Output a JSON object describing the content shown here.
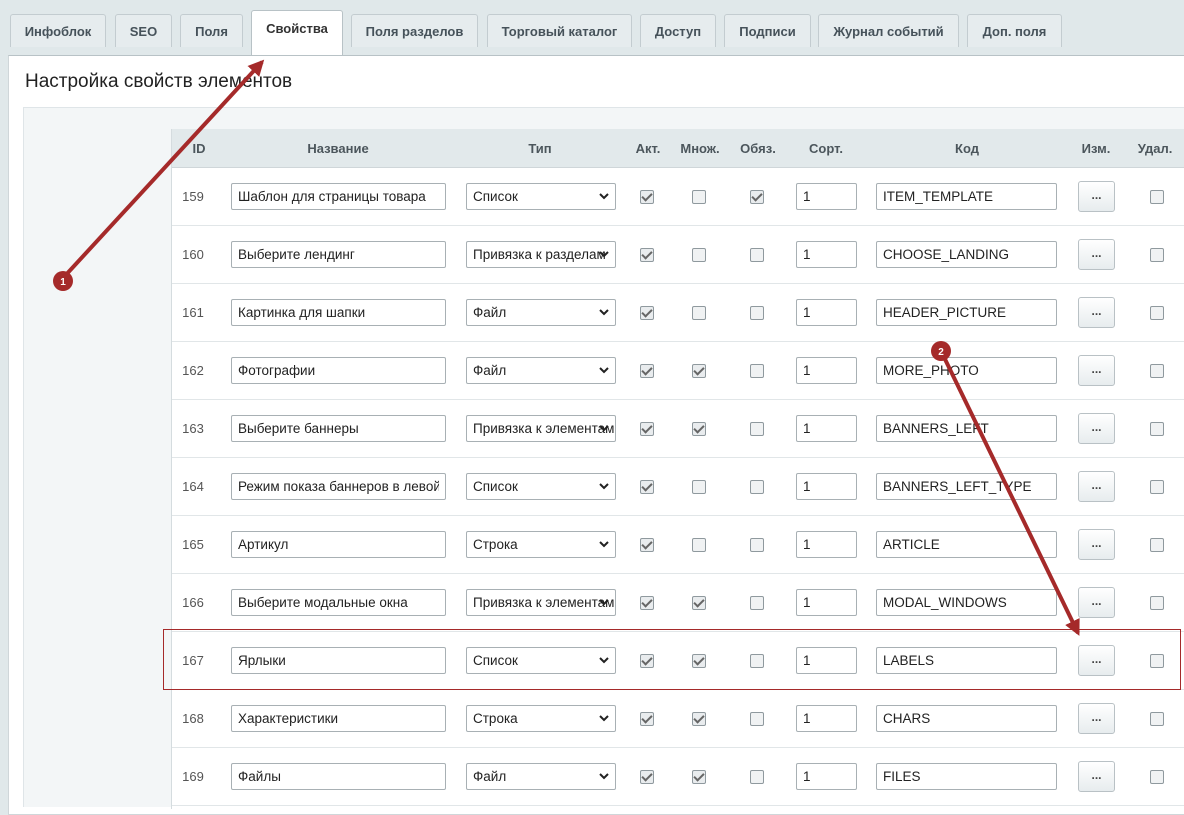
{
  "tabs": [
    {
      "label": "Инфоблок"
    },
    {
      "label": "SEO"
    },
    {
      "label": "Поля"
    },
    {
      "label": "Свойства",
      "active": true
    },
    {
      "label": "Поля разделов"
    },
    {
      "label": "Торговый каталог"
    },
    {
      "label": "Доступ"
    },
    {
      "label": "Подписи"
    },
    {
      "label": "Журнал событий"
    },
    {
      "label": "Доп. поля"
    }
  ],
  "page_title": "Настройка свойств элементов",
  "table": {
    "headers": {
      "id": "ID",
      "name": "Название",
      "type": "Тип",
      "active": "Акт.",
      "multiple": "Множ.",
      "required": "Обяз.",
      "sort": "Сорт.",
      "code": "Код",
      "edit": "Изм.",
      "delete": "Удал."
    },
    "edit_label": "...",
    "rows": [
      {
        "id": "159",
        "name": "Шаблон для страницы товара",
        "type": "Список",
        "active": true,
        "multiple": false,
        "required": true,
        "sort": "1",
        "code": "ITEM_TEMPLATE",
        "delete": false
      },
      {
        "id": "160",
        "name": "Выберите лендинг",
        "type": "Привязка к разделам",
        "active": true,
        "multiple": false,
        "required": false,
        "sort": "1",
        "code": "CHOOSE_LANDING",
        "delete": false
      },
      {
        "id": "161",
        "name": "Картинка для шапки",
        "type": "Файл",
        "active": true,
        "multiple": false,
        "required": false,
        "sort": "1",
        "code": "HEADER_PICTURE",
        "delete": false
      },
      {
        "id": "162",
        "name": "Фотографии",
        "type": "Файл",
        "active": true,
        "multiple": true,
        "required": false,
        "sort": "1",
        "code": "MORE_PHOTO",
        "delete": false
      },
      {
        "id": "163",
        "name": "Выберите баннеры",
        "type": "Привязка к элементам",
        "active": true,
        "multiple": true,
        "required": false,
        "sort": "1",
        "code": "BANNERS_LEFT",
        "delete": false
      },
      {
        "id": "164",
        "name": "Режим показа баннеров в левой колонке",
        "type": "Список",
        "active": true,
        "multiple": false,
        "required": false,
        "sort": "1",
        "code": "BANNERS_LEFT_TYPE",
        "delete": false
      },
      {
        "id": "165",
        "name": "Артикул",
        "type": "Строка",
        "active": true,
        "multiple": false,
        "required": false,
        "sort": "1",
        "code": "ARTICLE",
        "delete": false
      },
      {
        "id": "166",
        "name": "Выберите модальные окна",
        "type": "Привязка к элементам",
        "active": true,
        "multiple": true,
        "required": false,
        "sort": "1",
        "code": "MODAL_WINDOWS",
        "delete": false
      },
      {
        "id": "167",
        "name": "Ярлыки",
        "type": "Список",
        "active": true,
        "multiple": true,
        "required": false,
        "sort": "1",
        "code": "LABELS",
        "delete": false,
        "highlighted": true
      },
      {
        "id": "168",
        "name": "Характеристики",
        "type": "Строка",
        "active": true,
        "multiple": true,
        "required": false,
        "sort": "1",
        "code": "CHARS",
        "delete": false
      },
      {
        "id": "169",
        "name": "Файлы",
        "type": "Файл",
        "active": true,
        "multiple": true,
        "required": false,
        "sort": "1",
        "code": "FILES",
        "delete": false
      }
    ]
  },
  "annotations": {
    "badge1": "1",
    "badge2": "2",
    "accent_color": "#a52a2a"
  }
}
